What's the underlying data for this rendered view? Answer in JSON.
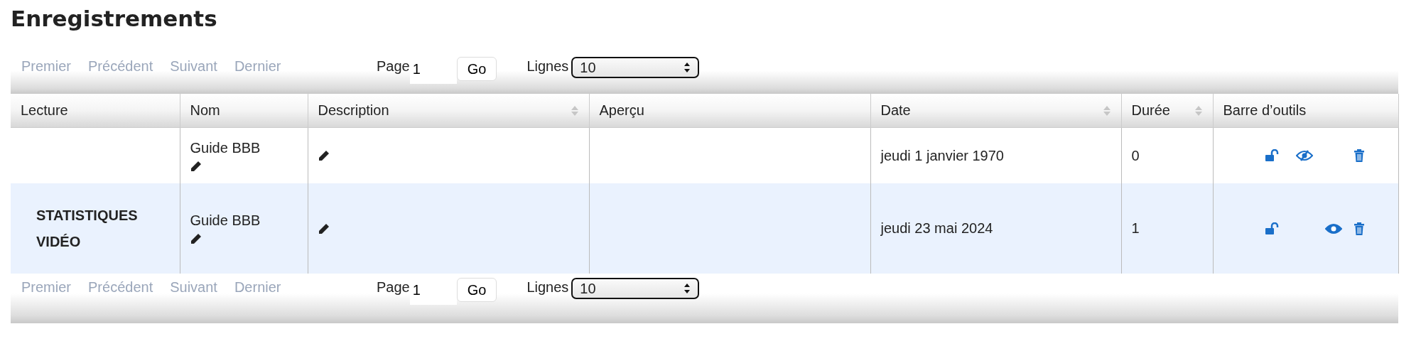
{
  "title": "Enregistrements",
  "pagers": [
    {
      "links": [
        {
          "label": "Premier",
          "disabled": true
        },
        {
          "label": "Précédent",
          "disabled": true
        },
        {
          "label": "Suivant",
          "disabled": true
        },
        {
          "label": "Dernier",
          "disabled": true
        }
      ],
      "page_label": "Page",
      "page_value": "1",
      "go": "Go",
      "rows_label": "Lignes",
      "rows_value": "10"
    },
    {
      "links": [
        {
          "label": "Premier",
          "disabled": true
        },
        {
          "label": "Précédent",
          "disabled": true
        },
        {
          "label": "Suivant",
          "disabled": true
        },
        {
          "label": "Dernier",
          "disabled": true
        }
      ],
      "page_label": "Page",
      "page_value": "1",
      "go": "Go",
      "rows_label": "Lignes",
      "rows_value": "10"
    }
  ],
  "columns": [
    {
      "label": "Lecture",
      "sortable": false
    },
    {
      "label": "Nom",
      "sortable": false
    },
    {
      "label": "Description",
      "sortable": true
    },
    {
      "label": "Aperçu",
      "sortable": false
    },
    {
      "label": "Date",
      "sortable": true
    },
    {
      "label": "Durée",
      "sortable": true
    },
    {
      "label": "Barre d’outils",
      "sortable": false
    }
  ],
  "rows": [
    {
      "selected": false,
      "playback": [],
      "name": "Guide BBB",
      "date": "jeudi 1 janvier 1970",
      "duration": "0",
      "visible": false
    },
    {
      "selected": true,
      "playback": [
        "STATISTIQUES",
        "VIDÉO"
      ],
      "name": "Guide BBB",
      "date": "jeudi 23 mai 2024",
      "duration": "1",
      "visible": true
    }
  ]
}
